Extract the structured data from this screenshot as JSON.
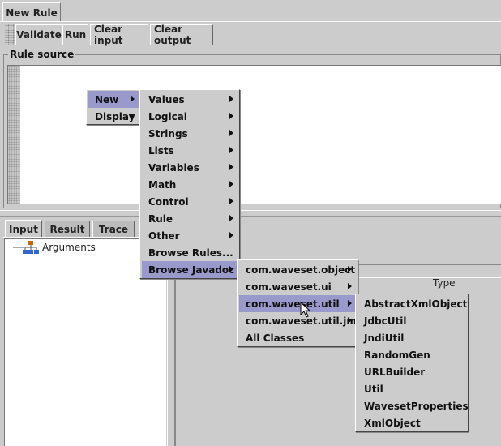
{
  "window": {
    "tab_label": "New Rule"
  },
  "toolbar": {
    "validate_label": "Validate",
    "run_label": "Run",
    "clear_input_label": "Clear input",
    "clear_output_label": "Clear output"
  },
  "rule_source": {
    "title": "Rule source"
  },
  "bottom_tabs": [
    {
      "label": "Input"
    },
    {
      "label": "Result"
    },
    {
      "label": "Trace"
    }
  ],
  "tree": {
    "root_label": "Arguments"
  },
  "table": {
    "type_header": "Type"
  },
  "menus": {
    "root": [
      {
        "label": "New"
      },
      {
        "label": "Display"
      }
    ],
    "new_submenu": [
      {
        "label": "Values"
      },
      {
        "label": "Logical"
      },
      {
        "label": "Strings"
      },
      {
        "label": "Lists"
      },
      {
        "label": "Variables"
      },
      {
        "label": "Math"
      },
      {
        "label": "Control"
      },
      {
        "label": "Rule"
      },
      {
        "label": "Other"
      },
      {
        "label": "Browse Rules..."
      },
      {
        "label": "Browse Javadoc"
      }
    ],
    "javadoc_submenu": [
      {
        "label": "com.waveset.object"
      },
      {
        "label": "com.waveset.ui"
      },
      {
        "label": "com.waveset.util"
      },
      {
        "label": "com.waveset.util.jms"
      },
      {
        "label": "All Classes"
      }
    ],
    "util_submenu": [
      {
        "label": "AbstractXmlObject"
      },
      {
        "label": "JdbcUtil"
      },
      {
        "label": "JndiUtil"
      },
      {
        "label": "RandomGen"
      },
      {
        "label": "URLBuilder"
      },
      {
        "label": "Util"
      },
      {
        "label": "WavesetProperties"
      },
      {
        "label": "XmlObject"
      }
    ]
  },
  "colors": {
    "background": "#cccccc",
    "menu_highlight": "#9999cc",
    "tree_icon": "#cc6600"
  }
}
